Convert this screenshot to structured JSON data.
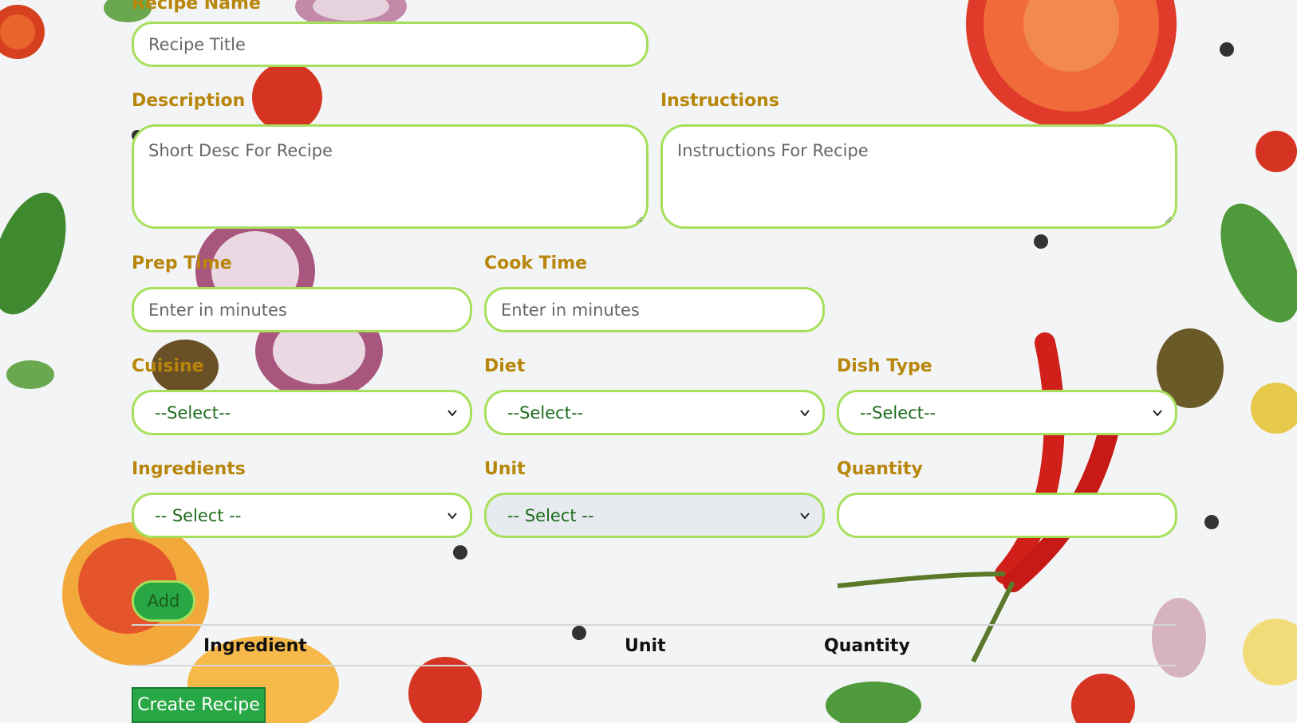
{
  "form": {
    "recipe_name_label": "Recipe Name",
    "recipe_title_placeholder": "Recipe Title",
    "description_label": "Description",
    "description_placeholder": "Short Desc For Recipe",
    "instructions_label": "Instructions",
    "instructions_placeholder": "Instructions For Recipe",
    "prep_time_label": "Prep Time",
    "prep_time_placeholder": "Enter in minutes",
    "cook_time_label": "Cook Time",
    "cook_time_placeholder": "Enter in minutes",
    "cuisine_label": "Cuisine",
    "cuisine_value": "--Select--",
    "diet_label": "Diet",
    "diet_value": "--Select--",
    "dish_type_label": "Dish Type",
    "dish_type_value": "--Select--",
    "ingredients_label": "Ingredients",
    "ingredients_value": "-- Select --",
    "unit_label": "Unit",
    "unit_value": "-- Select --",
    "quantity_label": "Quantity",
    "quantity_value": ""
  },
  "add_button": "Add",
  "table": {
    "headers": [
      "Ingredient",
      "Unit",
      "Quantity"
    ]
  },
  "create_button": "Create Recipe",
  "colors": {
    "label": "#b8860b",
    "border": "#a6e05a",
    "button": "#28a745",
    "select_text": "#1d6b1d"
  }
}
